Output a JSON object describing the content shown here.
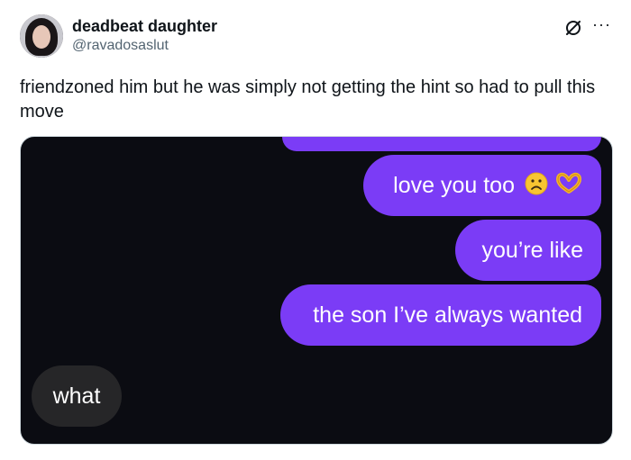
{
  "author": {
    "name": "deadbeat daughter",
    "handle": "@ravadosaslut"
  },
  "header_icons": {
    "grok": "grok-icon",
    "more": "more-options-icon"
  },
  "tweet": {
    "text": "friendzoned him but he was simply not getting the hint so had to pull this move"
  },
  "media": {
    "background": "#0b0c12",
    "sent_bubble_color": "#7b3cf6",
    "received_bubble_color": "#262628",
    "messages": [
      {
        "from": "me",
        "text": "love you too",
        "emojis": [
          "frowning-face-emoji",
          "heart-hands-emoji"
        ]
      },
      {
        "from": "me",
        "text": "you’re like"
      },
      {
        "from": "me",
        "text": "the son I’ve always wanted"
      },
      {
        "from": "them",
        "text": "what"
      }
    ]
  }
}
